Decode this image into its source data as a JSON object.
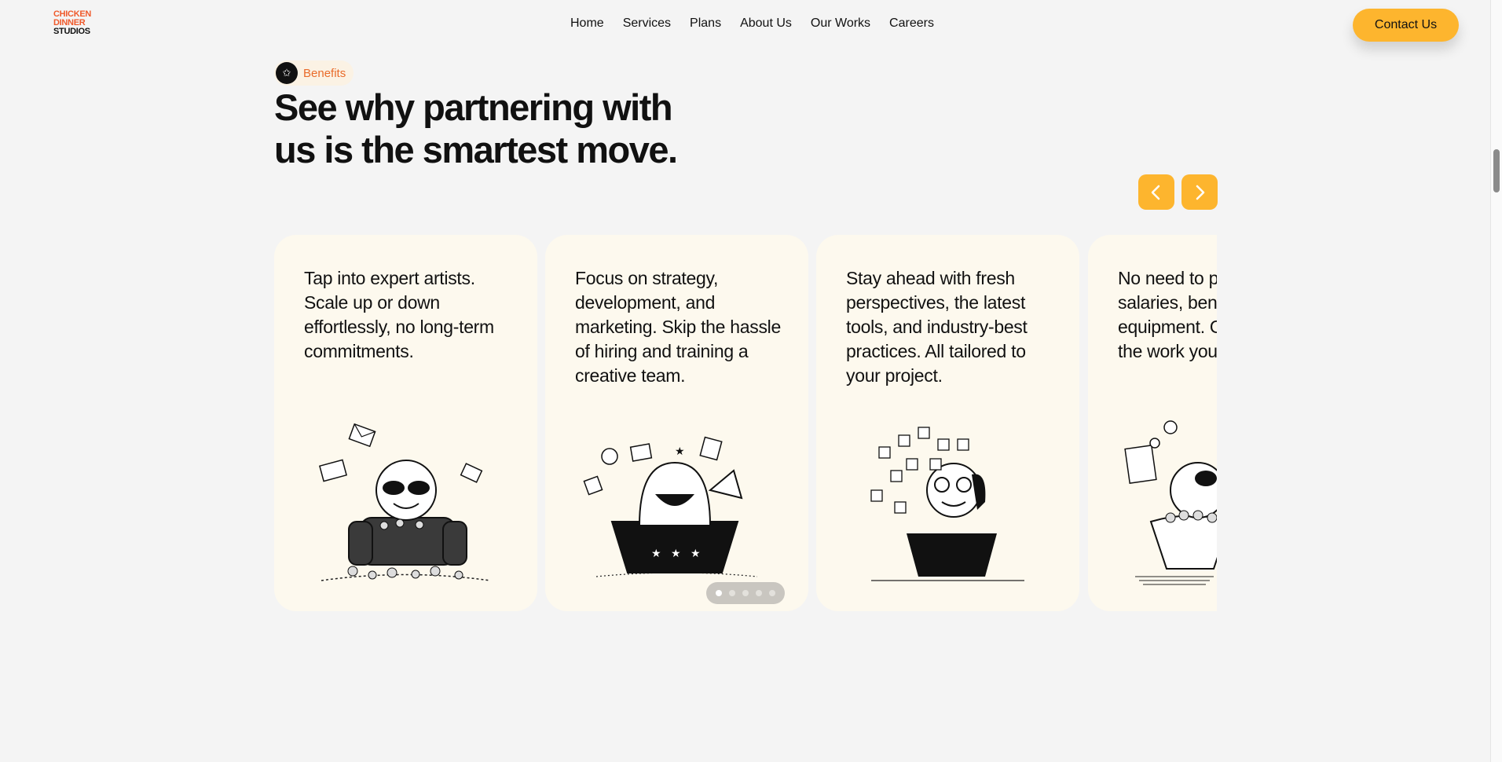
{
  "brand": {
    "line1": "CHICKEN",
    "line2": "DINNER",
    "line3": "STUDIOS",
    "accent": "#ef5a2c"
  },
  "nav": {
    "items": [
      {
        "label": "Home"
      },
      {
        "label": "Services"
      },
      {
        "label": "Plans"
      },
      {
        "label": "About Us"
      },
      {
        "label": "Our Works"
      },
      {
        "label": "Careers"
      }
    ]
  },
  "contact": {
    "label": "Contact Us",
    "color": "#fdb52e"
  },
  "section": {
    "badge_icon": "star-icon",
    "badge": "Benefits",
    "headline_line1": "See why partnering with",
    "headline_line2": "us is the smartest move."
  },
  "carousel": {
    "prev_icon": "chevron-left-icon",
    "next_icon": "chevron-right-icon",
    "cards": [
      {
        "text": "Tap into expert artists. Scale up or down effortlessly, no long-term commitments.",
        "illustration": "character-in-armchair-with-sunglasses"
      },
      {
        "text": "Focus on strategy, development, and marketing. Skip the hassle of hiring and training a creative team.",
        "illustration": "character-in-bowl-with-megaphone"
      },
      {
        "text": "Stay ahead with fresh perspectives, the latest tools, and industry-best practices. All tailored to your project.",
        "illustration": "character-with-puzzle-pieces"
      },
      {
        "text": "No need to pay full-time salaries, benefits, or equipment. Only pay for the work you need.",
        "illustration": "character-in-bowl-with-coins"
      }
    ],
    "pagination": {
      "total": 5,
      "active": 1
    }
  }
}
